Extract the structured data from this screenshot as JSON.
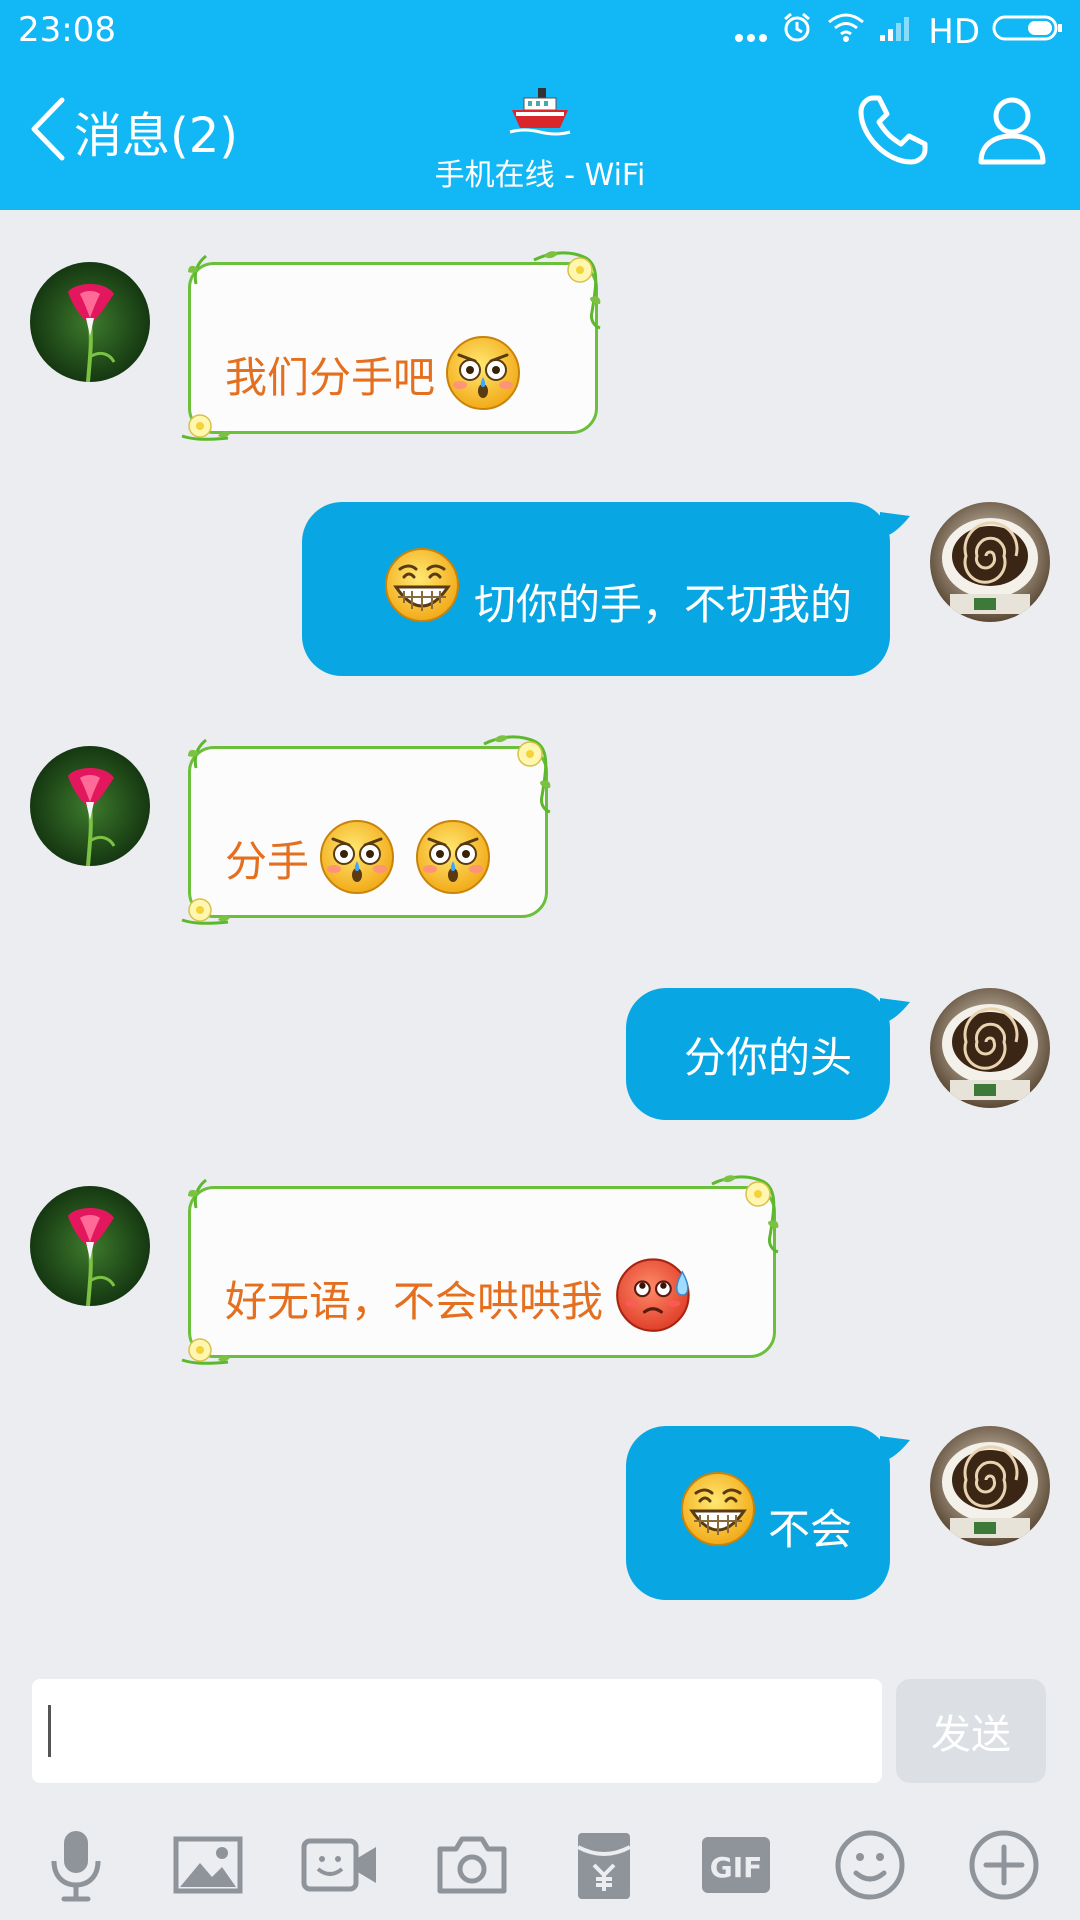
{
  "status_bar": {
    "time": "23:08",
    "network": "HD"
  },
  "header": {
    "back_label": "消息(2)",
    "subtitle": "手机在线 - WiFi"
  },
  "messages": [
    {
      "side": "in",
      "text": "我们分手吧",
      "emoji": [
        "shocked"
      ]
    },
    {
      "side": "out",
      "text": "切你的手，不切我的",
      "emoji": [
        "grin"
      ]
    },
    {
      "side": "in",
      "text": "分手",
      "emoji": [
        "shocked",
        "shocked"
      ]
    },
    {
      "side": "out",
      "text": "分你的头",
      "emoji": []
    },
    {
      "side": "in",
      "text": "好无语，不会哄哄我",
      "emoji": [
        "awkward-sweat"
      ]
    },
    {
      "side": "out",
      "text": "不会",
      "emoji": [
        "grin"
      ]
    }
  ],
  "input": {
    "value": "",
    "send_label": "发送"
  },
  "toolbar": [
    "microphone-icon",
    "image-icon",
    "video-call-icon",
    "camera-icon",
    "red-packet-icon",
    "gif-icon",
    "emoji-icon",
    "plus-icon"
  ],
  "colors": {
    "header": "#12b7f5",
    "bubble_out": "#08a6e2",
    "bubble_in_text": "#e46f1f",
    "bubble_in_border": "#6bbf3a",
    "background": "#ebedf1"
  }
}
